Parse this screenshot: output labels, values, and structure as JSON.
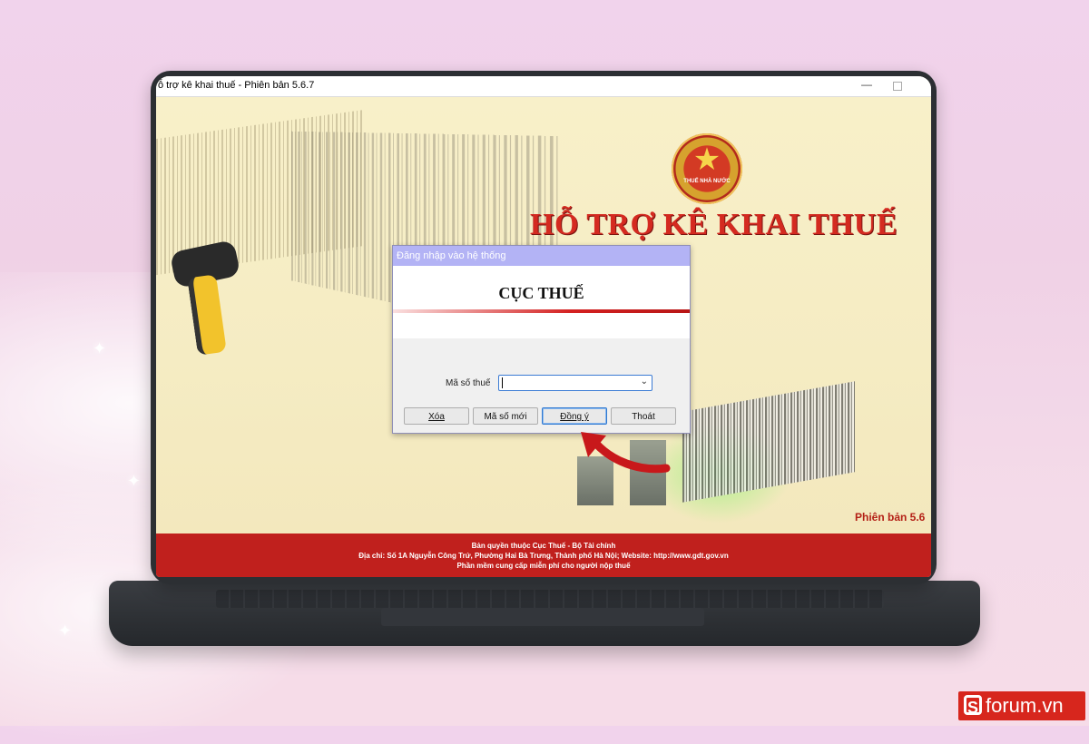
{
  "window": {
    "title": "ỗ trợ kê khai thuế -  Phiên bản 5.6.7",
    "minimize_glyph": "—"
  },
  "app": {
    "emblem_text": "THUẾ NHÀ NƯỚC",
    "main_title": "HỖ TRỢ KÊ KHAI THUẾ",
    "version_label": "Phiên bản 5.6"
  },
  "footer": {
    "line1": "Bản quyền thuộc Cục Thuế - Bộ Tài chính",
    "line2": "Địa chỉ: Số 1A Nguyễn Công Trứ, Phường Hai Bà Trưng, Thành phố Hà Nội; Website: http://www.gdt.gov.vn",
    "line3": "Phần mềm cung cấp miễn phí cho người nộp thuế"
  },
  "dialog": {
    "title": "Đăng nhập vào hệ thống",
    "banner": "CỤC THUẾ",
    "field_label": "Mã số thuế",
    "field_value": "",
    "buttons": {
      "clear": "Xóa",
      "new_tax_code": "Mã số mới",
      "ok": "Đồng ý",
      "exit": "Thoát"
    }
  },
  "brand": {
    "logo_letter": "S",
    "text": "forum.vn"
  },
  "colors": {
    "app_title_red": "#d42a20",
    "footer_red": "#c0201d",
    "dialog_titlebar": "#b3b3f5",
    "primary_focus": "#2f78d0"
  },
  "icons": {
    "chevron": "chevron-down-icon",
    "arrow": "curved-red-arrow-icon",
    "emblem": "tax-emblem-icon"
  }
}
